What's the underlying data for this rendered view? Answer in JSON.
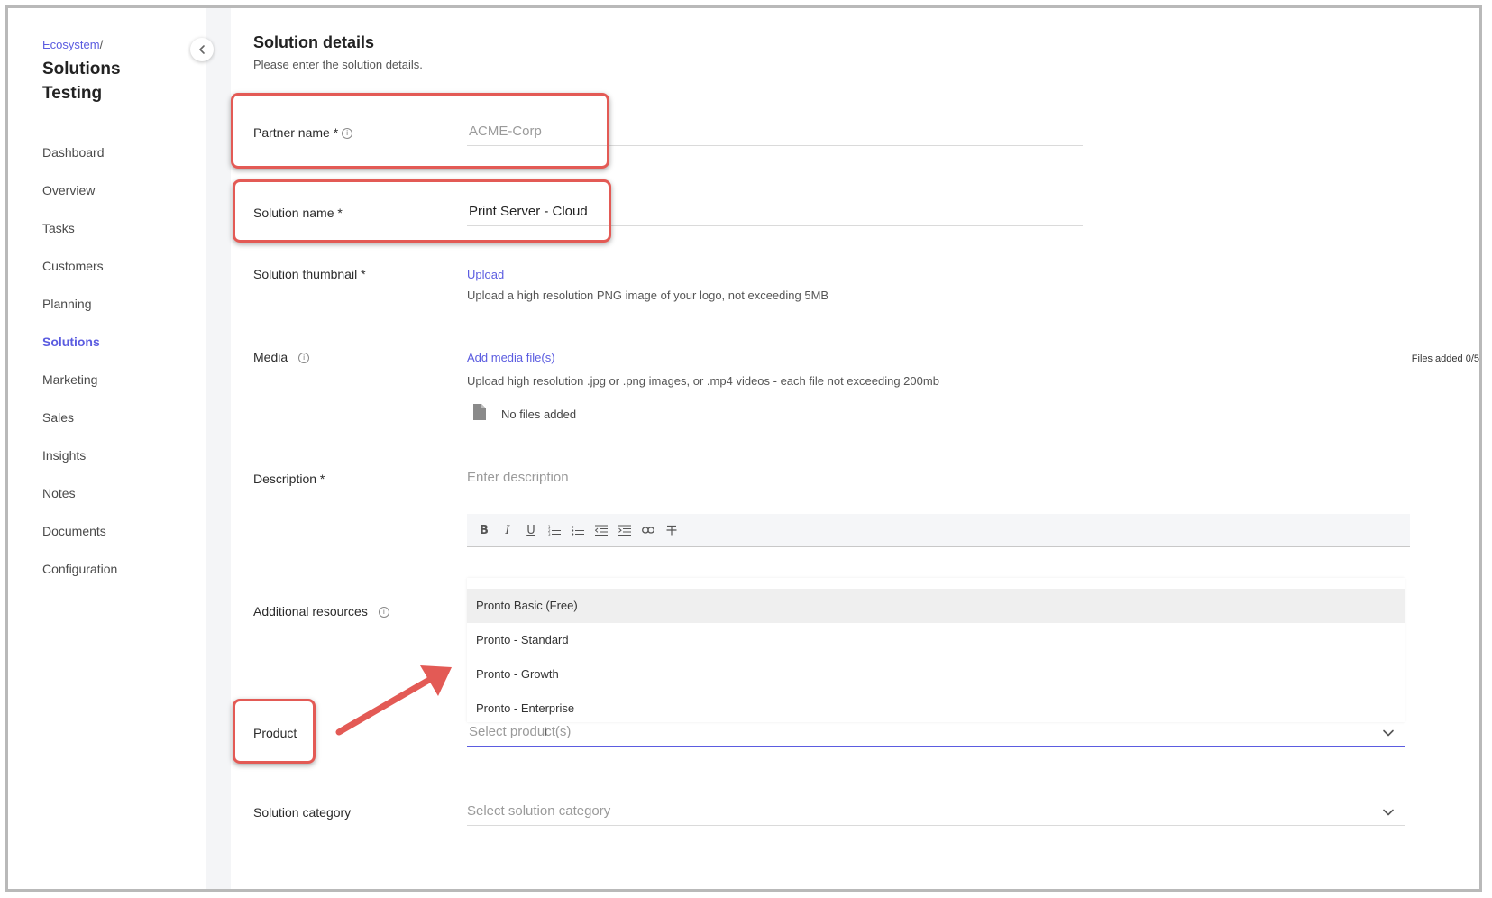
{
  "sidebar": {
    "breadcrumb": "Ecosystem",
    "breadcrumb_sep": "/",
    "title": "Solutions Testing",
    "items": [
      {
        "label": "Dashboard"
      },
      {
        "label": "Overview"
      },
      {
        "label": "Tasks"
      },
      {
        "label": "Customers"
      },
      {
        "label": "Planning"
      },
      {
        "label": "Solutions",
        "active": true
      },
      {
        "label": "Marketing"
      },
      {
        "label": "Sales"
      },
      {
        "label": "Insights"
      },
      {
        "label": "Notes"
      },
      {
        "label": "Documents"
      },
      {
        "label": "Configuration"
      }
    ]
  },
  "header": {
    "title": "Solution details",
    "subtitle": "Please enter the solution details."
  },
  "form": {
    "partner_name": {
      "label": "Partner name *",
      "value": "ACME-Corp"
    },
    "solution_name": {
      "label": "Solution name *",
      "value": "Print Server - Cloud"
    },
    "thumbnail": {
      "label": "Solution thumbnail *",
      "link": "Upload",
      "help": "Upload a high resolution PNG image of your logo, not exceeding 5MB"
    },
    "media": {
      "label": "Media",
      "link": "Add media file(s)",
      "help": "Upload high resolution .jpg or .png images, or .mp4 videos - each file not exceeding 200mb",
      "count": "Files added 0/5",
      "empty": "No files added"
    },
    "description": {
      "label": "Description *",
      "placeholder": "Enter description"
    },
    "additional_resources": {
      "label": "Additional resources"
    },
    "product": {
      "label": "Product",
      "placeholder": "Select product(s)",
      "options": [
        "Pronto Basic (Free)",
        "Pronto - Standard",
        "Pronto - Growth",
        "Pronto - Enterprise"
      ]
    },
    "category": {
      "label": "Solution category",
      "placeholder": "Select solution category"
    }
  },
  "colors": {
    "accent": "#5b5ce0",
    "highlight": "#e35a55"
  },
  "icons": {
    "collapse": "chevron-left-icon",
    "info": "info-icon",
    "file": "file-icon",
    "dropdown": "chevron-down-icon",
    "annotation": "arrow-annotation"
  }
}
